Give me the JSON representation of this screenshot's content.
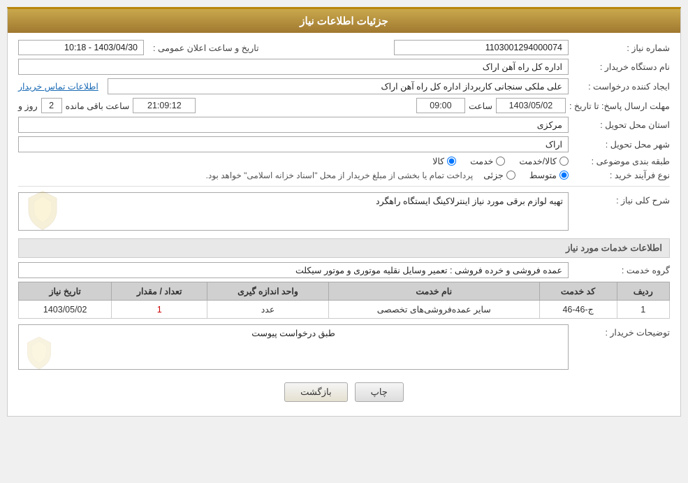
{
  "header": {
    "title": "جزئیات اطلاعات نیاز"
  },
  "fields": {
    "need_number_label": "شماره نیاز :",
    "need_number_value": "1103001294000074",
    "buyer_org_label": "نام دستگاه خریدار :",
    "buyer_org_value": "اداره کل راه آهن اراک",
    "creator_label": "ایجاد کننده درخواست :",
    "creator_value": "علی ملکی سنجانی کاربرداز اداره کل راه آهن اراک",
    "creator_link": "اطلاعات تماس خریدار",
    "announce_date_label": "تاریخ و ساعت اعلان عمومی :",
    "announce_date_value": "1403/04/30 - 10:18",
    "deadline_label": "مهلت ارسال پاسخ: تا تاریخ :",
    "deadline_date": "1403/05/02",
    "deadline_time_label": "ساعت",
    "deadline_time": "09:00",
    "deadline_remaining_label1": "روز و",
    "deadline_remaining_days": "2",
    "deadline_remaining_label2": "ساعت باقی مانده",
    "deadline_remaining_time": "21:09:12",
    "province_label": "استان محل تحویل :",
    "province_value": "مرکزی",
    "city_label": "شهر محل تحویل :",
    "city_value": "اراک",
    "category_label": "طبقه بندی موضوعی :",
    "category_options": [
      "کالا",
      "خدمت",
      "کالا/خدمت"
    ],
    "category_selected": "کالا",
    "purchase_type_label": "نوع فرآیند خرید :",
    "purchase_type_options": [
      "جزئی",
      "متوسط"
    ],
    "purchase_type_selected": "متوسط",
    "purchase_type_note": "پرداخت تمام یا بخشی از مبلغ خریدار از محل \"اسناد خزانه اسلامی\" خواهد بود.",
    "summary_title": "شرح کلی نیاز :",
    "summary_value": "تهیه لوازم برقی مورد نیاز اینترلاکینگ ایستگاه راهگرد",
    "services_title": "اطلاعات خدمات مورد نیاز",
    "service_group_label": "گروه خدمت :",
    "service_group_value": "عمده فروشی و خرده فروشی : تعمیر وسایل نقلیه موتوری و موتور سیکلت",
    "table": {
      "headers": [
        "ردیف",
        "کد خدمت",
        "نام خدمت",
        "واحد اندازه گیری",
        "تعداد / مقدار",
        "تاریخ نیاز"
      ],
      "rows": [
        {
          "row": "1",
          "code": "ج-46-46",
          "name": "سایر عمده‌فروشی‌های تخصصی",
          "unit": "عدد",
          "qty": "1",
          "date": "1403/05/02"
        }
      ]
    },
    "buyer_desc_label": "توضیحات خریدار :",
    "buyer_desc_value": "طبق درخواست پیوست"
  },
  "buttons": {
    "print": "چاپ",
    "back": "بازگشت"
  }
}
